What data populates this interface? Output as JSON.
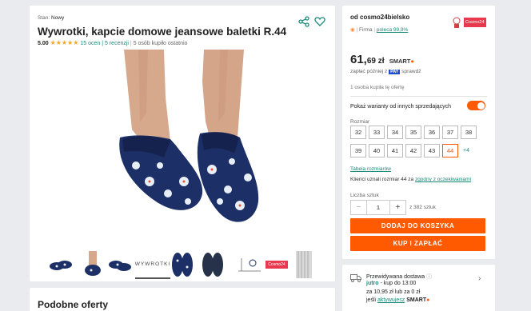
{
  "product": {
    "condition_label": "Stan:",
    "condition_value": "Nowy",
    "title": "Wywrotki, kapcie domowe jeansowe baletki R.44",
    "rating": "5.00",
    "stars": 5,
    "reviews": "15 ocen | 5 recenzji",
    "sold": "5 osób kupiło ostatnio",
    "thumbnail_text": "WYWROTKI",
    "thumb_logo_text": "Cosmo24"
  },
  "seller": {
    "from_label": "od cosmo24bielsko",
    "type": "Firma",
    "recommend": "poleca 99,9%",
    "logo_text": "Cosmo24"
  },
  "price": {
    "main": "61,",
    "cents": "69 zł",
    "smart_label": "SMART",
    "pay_later_prefix": "zapłać później z",
    "pay_badge": "PAY",
    "pay_later_suffix": "sprawdź",
    "bought_note": "1 osoba kupiła tę ofertę"
  },
  "variants": {
    "toggle_label": "Pokaż warianty od innych sprzedających",
    "toggle_on": true
  },
  "sizes": {
    "label": "Rozmiar",
    "row1": [
      "32",
      "33",
      "34",
      "35",
      "36",
      "37",
      "38"
    ],
    "row2": [
      "39",
      "40",
      "41",
      "42",
      "43",
      "44"
    ],
    "more": "+4",
    "selected": "44",
    "table_link": "Tabela rozmiarów",
    "fit_prefix": "Klienci uznali rozmiar 44 za",
    "fit_link": "zgodny z oczekiwaniami"
  },
  "quantity": {
    "label": "Liczba sztuk",
    "value": "1",
    "minus": "−",
    "plus": "+",
    "stock": "z 382 sztuk"
  },
  "buttons": {
    "add_to_cart": "DODAJ DO KOSZYKA",
    "buy_now": "KUP I ZAPŁAĆ"
  },
  "delivery": {
    "title": "Przewidywana dostawa",
    "line1_bold": "jutro",
    "line1_rest": "- kup do 13:00",
    "line2": "za 10,95 zł lub za 0 zł",
    "line3_prefix": "jeśli",
    "line3_link": "aktywujesz",
    "line3_smart": "SMART"
  },
  "similar": {
    "title": "Podobne oferty"
  },
  "colors": {
    "accent": "#ff5a00",
    "link": "#1b8a7a",
    "star": "#f5a623"
  }
}
